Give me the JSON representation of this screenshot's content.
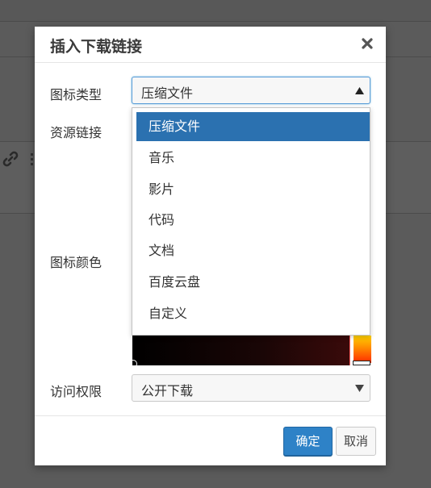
{
  "modal": {
    "title": "插入下载链接",
    "close_icon": "close-icon"
  },
  "form": {
    "icon_type_label": "图标类型",
    "icon_type_value": "压缩文件",
    "resource_link_label": "资源链接",
    "icon_color_label": "图标颜色",
    "access_label": "访问权限",
    "access_value": "公开下载"
  },
  "dropdown": {
    "options": [
      "压缩文件",
      "音乐",
      "影片",
      "代码",
      "文档",
      "百度云盘",
      "自定义"
    ],
    "selected_index": 0
  },
  "buttons": {
    "confirm": "确定",
    "cancel": "取消"
  },
  "colors": {
    "primary": "#2e82c7",
    "selected_option": "#2b71b0",
    "overlay": "#5b5b5b"
  }
}
